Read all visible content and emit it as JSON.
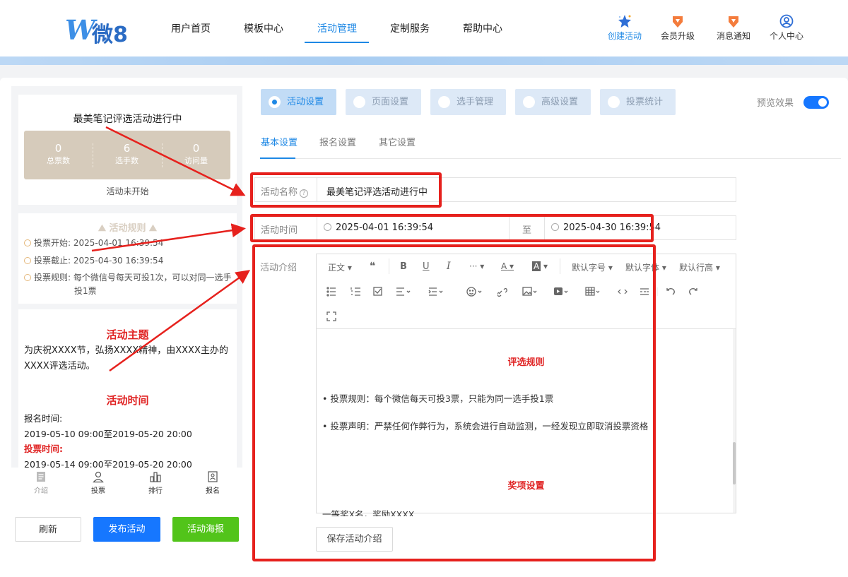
{
  "header": {
    "logo_w": "W",
    "logo_text": "微8",
    "nav": [
      {
        "label": "用户首页"
      },
      {
        "label": "模板中心"
      },
      {
        "label": "活动管理"
      },
      {
        "label": "定制服务"
      },
      {
        "label": "帮助中心"
      }
    ],
    "tools": [
      {
        "label": "创建活动",
        "icon": "star-icon"
      },
      {
        "label": "会员升级",
        "icon": "badge-icon"
      },
      {
        "label": "消息通知",
        "icon": "bell-icon"
      },
      {
        "label": "个人中心",
        "icon": "user-icon"
      }
    ]
  },
  "preview": {
    "title": "最美笔记评选活动进行中",
    "stats": [
      {
        "value": "0",
        "label": "总票数"
      },
      {
        "value": "6",
        "label": "选手数"
      },
      {
        "value": "0",
        "label": "访问量"
      }
    ],
    "status": "活动未开始",
    "rules_title": "活动规则",
    "rules": [
      {
        "label": "投票开始:",
        "value": "2025-04-01 16:39:54"
      },
      {
        "label": "投票截止:",
        "value": "2025-04-30 16:39:54"
      },
      {
        "label": "投票规则:",
        "value": "每个微信号每天可投1次，可以对同一选手",
        "value2": "投1票"
      }
    ],
    "theme_heading": "活动主题",
    "theme_text": "为庆祝XXXX节，弘扬XXXX精神，由XXXX主办的XXXX评选活动。",
    "time_heading": "活动时间",
    "signup_label": "报名时间:",
    "signup_value": "2019-05-10 09:00至2019-05-20 20:00",
    "vote_label": "投票时间:",
    "vote_value": "2019-05-14 09:00至2019-05-20 20:00",
    "tabbar": [
      {
        "label": "介绍"
      },
      {
        "label": "投票"
      },
      {
        "label": "排行"
      },
      {
        "label": "报名"
      }
    ]
  },
  "buttons": {
    "refresh": "刷新",
    "publish": "发布活动",
    "poster": "活动海报"
  },
  "settings": {
    "tabs": [
      {
        "label": "活动设置"
      },
      {
        "label": "页面设置"
      },
      {
        "label": "选手管理"
      },
      {
        "label": "高级设置"
      },
      {
        "label": "投票统计"
      }
    ],
    "preview_label": "预览效果",
    "preview_on": true,
    "subtabs": [
      {
        "label": "基本设置"
      },
      {
        "label": "报名设置"
      },
      {
        "label": "其它设置"
      }
    ],
    "name_label": "活动名称",
    "name_value": "最美笔记评选活动进行中",
    "time_label": "活动时间",
    "time_start": "2025-04-01 16:39:54",
    "time_to": "至",
    "time_end": "2025-04-30 16:39:54",
    "intro_label": "活动介绍",
    "toolbar": {
      "paragraph": "正文",
      "quote": "❝",
      "bold": "B",
      "underline": "U",
      "italic": "I",
      "more": "···",
      "font_color": "A",
      "bg_color": "A",
      "font_size": "默认字号",
      "font_family": "默认字体",
      "line_height": "默认行高"
    },
    "editor": {
      "rules_heading": "评选规则",
      "rule1": "• 投票规则：每个微信每天可投3票，只能为同一选手投1票",
      "rule2": "• 投票声明：严禁任何作弊行为，系统会进行自动监测，一经发现立即取消投票资格",
      "prize_heading": "奖项设置",
      "prize_line": "一等奖X名，奖励XXXX"
    },
    "save_label": "保存活动介绍"
  },
  "colors": {
    "accent": "#1e88e5",
    "highlight": "#e6211d",
    "publish": "#1677ff",
    "poster": "#52c41a"
  }
}
